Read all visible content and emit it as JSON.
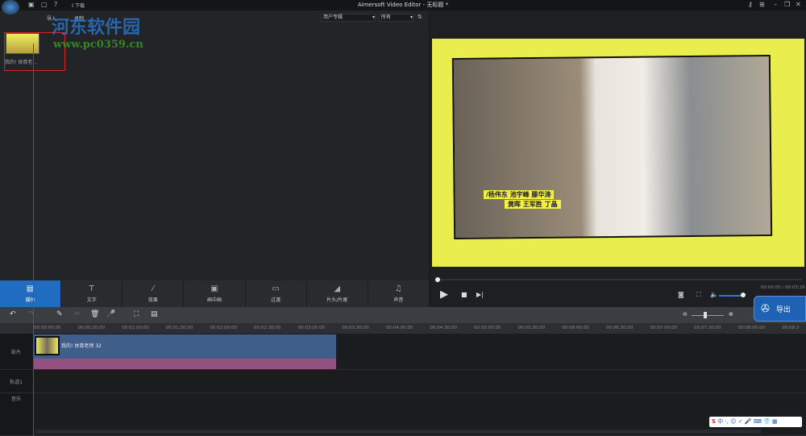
{
  "titlebar": {
    "title": "Aimersoft Video Editor - 无标题 *",
    "download": "⇩下载"
  },
  "media": {
    "import": "导入",
    "record": "录制",
    "album": "用户专辑",
    "filter": "所有",
    "item_label": "我的! 体育老..."
  },
  "watermark": {
    "name": "河东软件园",
    "url": "www.pc0359.cn"
  },
  "preview": {
    "caption1": "/杨伟东 池宇峰 滕华涛",
    "caption2": "黄晖 王军胜 丁晶",
    "time": "00:00:00 / 00:03:26",
    "volume": 0.85,
    "progress": 0.0
  },
  "tabs": [
    {
      "label": "媒体",
      "icon": "▤"
    },
    {
      "label": "文字",
      "icon": "T"
    },
    {
      "label": "效果",
      "icon": "⁄"
    },
    {
      "label": "画中画",
      "icon": "▣"
    },
    {
      "label": "过渡",
      "icon": "▭"
    },
    {
      "label": "片头/片尾",
      "icon": "◢"
    },
    {
      "label": "声音",
      "icon": "♫"
    }
  ],
  "export": "导出",
  "ruler": [
    "00:00:00:00",
    "00:00:30:00",
    "00:01:00:00",
    "00:01:30:00",
    "00:02:00:00",
    "00:02:30:00",
    "00:03:00:00",
    "00:03:30:00",
    "00:04:00:00",
    "00:04:30:00",
    "00:05:00:00",
    "00:05:30:00",
    "00:06:00:00",
    "00:06:30:00",
    "00:07:00:00",
    "00:07:30:00",
    "00:08:00:00",
    "00:08:3"
  ],
  "tracks": {
    "video": "影片",
    "track1": "轨道1",
    "music": "音乐"
  },
  "clip": {
    "label": "我的! 体育老师 32"
  }
}
